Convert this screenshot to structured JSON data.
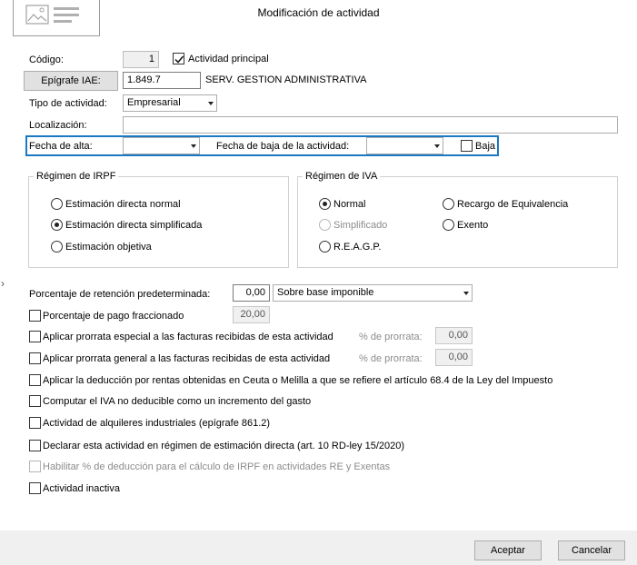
{
  "title": "Modificación de actividad",
  "codigo": {
    "label": "Código:",
    "value": "1"
  },
  "actividad_principal": {
    "label": "Actividad principal",
    "checked": true
  },
  "epigrafe": {
    "button_label": "Epígrafe IAE:",
    "value": "1.849.7",
    "description": "SERV. GESTION ADMINISTRATIVA"
  },
  "tipo_actividad": {
    "label": "Tipo de actividad:",
    "value": "Empresarial"
  },
  "localizacion": {
    "label": "Localización:",
    "value": ""
  },
  "fechas": {
    "alta_label": "Fecha de alta:",
    "alta_value": "",
    "baja_label": "Fecha de baja de la actividad:",
    "baja_value": "",
    "baja_check_label": "Baja",
    "baja_checked": false
  },
  "irpf": {
    "title": "Régimen de IRPF",
    "options": [
      {
        "label": "Estimación directa normal",
        "selected": false
      },
      {
        "label": "Estimación directa simplificada",
        "selected": true
      },
      {
        "label": "Estimación objetiva",
        "selected": false
      }
    ]
  },
  "iva": {
    "title": "Régimen de IVA",
    "options": [
      {
        "label": "Normal",
        "selected": true,
        "disabled": false
      },
      {
        "label": "Simplificado",
        "selected": false,
        "disabled": true
      },
      {
        "label": "R.E.A.G.P.",
        "selected": false,
        "disabled": false
      },
      {
        "label": "Recargo de Equivalencia",
        "selected": false,
        "disabled": false
      },
      {
        "label": "Exento",
        "selected": false,
        "disabled": false
      }
    ]
  },
  "retencion": {
    "label": "Porcentaje de retención predeterminada:",
    "value": "0,00",
    "base": "Sobre base imponible"
  },
  "pago_fraccionado": {
    "label": "Porcentaje de pago fraccionado",
    "value": "20,00"
  },
  "prorrata_especial": {
    "label": "Aplicar prorrata especial a las facturas recibidas de esta actividad",
    "pct_label": "% de prorrata:",
    "value": "0,00"
  },
  "prorrata_general": {
    "label": "Aplicar prorrata general a las facturas recibidas de esta actividad",
    "pct_label": "% de prorrata:",
    "value": "0,00"
  },
  "checks": [
    {
      "label": "Aplicar la deducción por rentas obtenidas en Ceuta o Melilla a que se refiere el artículo 68.4 de la Ley del Impuesto",
      "checked": false,
      "disabled": false
    },
    {
      "label": "Computar el IVA no deducible como un incremento del gasto",
      "checked": false,
      "disabled": false
    },
    {
      "label": "Actividad de alquileres industriales (epígrafe 861.2)",
      "checked": false,
      "disabled": false
    },
    {
      "label": "Declarar esta actividad en régimen de estimación directa (art. 10 RD-ley 15/2020)",
      "checked": false,
      "disabled": false
    },
    {
      "label": "Habilitar % de deducción para el cálculo de IRPF en actividades RE y Exentas",
      "checked": false,
      "disabled": true
    },
    {
      "label": "Actividad inactiva",
      "checked": false,
      "disabled": false
    }
  ],
  "buttons": {
    "accept": "Aceptar",
    "cancel": "Cancelar"
  },
  "side_marker": "›",
  "colors": {
    "focus_frame": "#1979c3",
    "footer_bg": "#f0f0f0",
    "button_bg": "#e1e1e1"
  }
}
